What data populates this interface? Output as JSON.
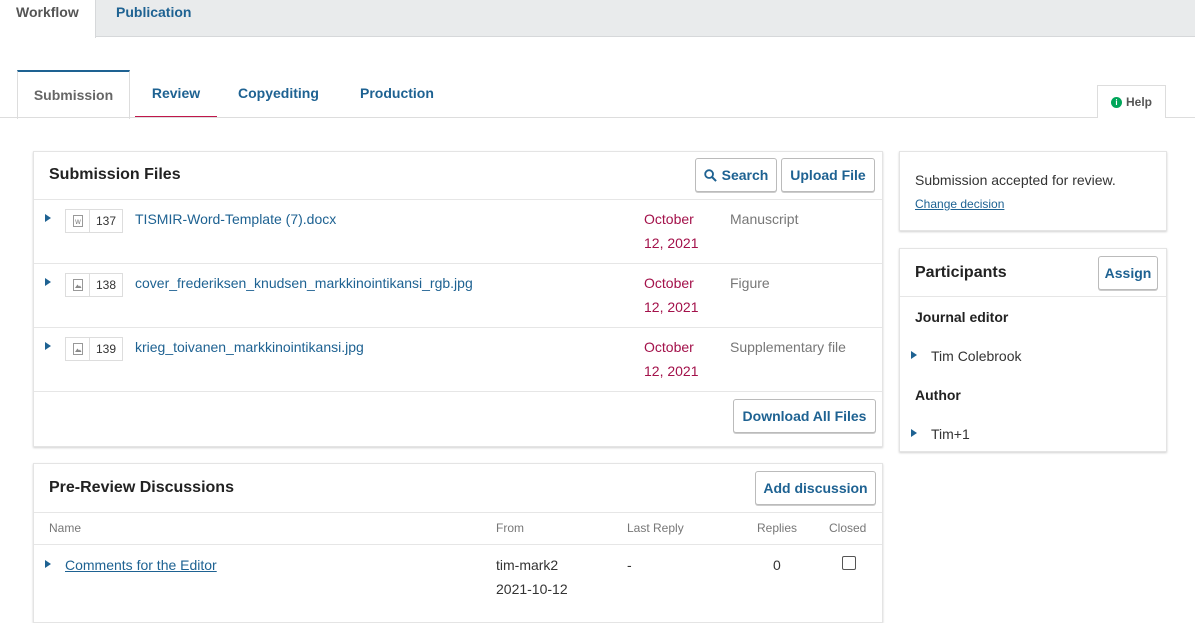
{
  "top_tabs": {
    "workflow": "Workflow",
    "publication": "Publication"
  },
  "sub_tabs": {
    "submission": "Submission",
    "review": "Review",
    "copyediting": "Copyediting",
    "production": "Production"
  },
  "help": {
    "label": "Help"
  },
  "submission_files": {
    "title": "Submission Files",
    "search_label": "Search",
    "upload_label": "Upload File",
    "download_all_label": "Download All Files",
    "files": [
      {
        "id": "137",
        "name": "TISMIR-Word-Template (7).docx",
        "date_line1": "October",
        "date_line2": "12, 2021",
        "type": "Manuscript"
      },
      {
        "id": "138",
        "name": "cover_frederiksen_knudsen_markkinointikansi_rgb.jpg",
        "date_line1": "October",
        "date_line2": "12, 2021",
        "type": "Figure"
      },
      {
        "id": "139",
        "name": "krieg_toivanen_markkinointikansi.jpg",
        "date_line1": "October",
        "date_line2": "12, 2021",
        "type": "Supplementary file"
      }
    ]
  },
  "discussions": {
    "title": "Pre-Review Discussions",
    "add_label": "Add discussion",
    "columns": {
      "name": "Name",
      "from": "From",
      "last_reply": "Last Reply",
      "replies": "Replies",
      "closed": "Closed"
    },
    "rows": [
      {
        "name": "Comments for the Editor",
        "from_user": "tim-mark2",
        "from_date": "2021-10-12",
        "last_reply": "-",
        "replies": "0",
        "closed": false
      }
    ]
  },
  "decision": {
    "status": "Submission accepted for review.",
    "change_label": "Change decision"
  },
  "participants": {
    "title": "Participants",
    "assign_label": "Assign",
    "groups": [
      {
        "role": "Journal editor",
        "members": [
          "Tim Colebrook"
        ]
      },
      {
        "role": "Author",
        "members": [
          "Tim+1"
        ]
      }
    ]
  },
  "colors": {
    "link": "#1e6292",
    "date": "#a3114a",
    "review_underline": "#c0174b",
    "help_icon": "#00a65a"
  }
}
